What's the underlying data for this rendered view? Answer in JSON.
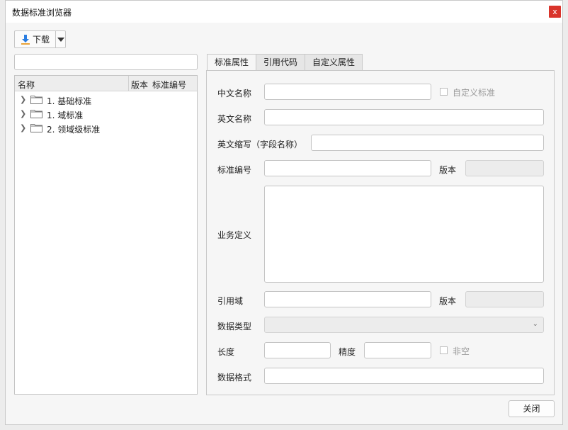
{
  "window": {
    "title": "数据标准浏览器",
    "close_glyph": "x"
  },
  "toolbar": {
    "download_label": "下载"
  },
  "search": {
    "value": "",
    "placeholder": ""
  },
  "tree": {
    "columns": [
      "名称",
      "版本",
      "标准编号"
    ],
    "items": [
      {
        "label": "1. 基础标准"
      },
      {
        "label": "1. 域标准"
      },
      {
        "label": "2. 领域级标准"
      }
    ]
  },
  "tabs": [
    "标准属性",
    "引用代码",
    "自定义属性"
  ],
  "form": {
    "chinese_name": {
      "label": "中文名称",
      "value": ""
    },
    "custom_standard": {
      "label": "自定义标准",
      "checked": false
    },
    "english_name": {
      "label": "英文名称",
      "value": ""
    },
    "english_code": {
      "label": "英文缩写（字段名称）",
      "value": ""
    },
    "standard_no": {
      "label": "标准编号",
      "value": ""
    },
    "version_1": {
      "label": "版本",
      "value": ""
    },
    "business_def": {
      "label": "业务定义",
      "value": ""
    },
    "ref_domain": {
      "label": "引用域",
      "value": ""
    },
    "version_2": {
      "label": "版本",
      "value": ""
    },
    "data_type": {
      "label": "数据类型",
      "value": ""
    },
    "length": {
      "label": "长度",
      "value": ""
    },
    "precision": {
      "label": "精度",
      "value": ""
    },
    "not_null": {
      "label": "非空",
      "checked": false
    },
    "data_format": {
      "label": "数据格式",
      "value": ""
    }
  },
  "footer": {
    "close_label": "关闭"
  },
  "colors": {
    "close_red": "#d9342b",
    "download_blue": "#2a7de1"
  }
}
